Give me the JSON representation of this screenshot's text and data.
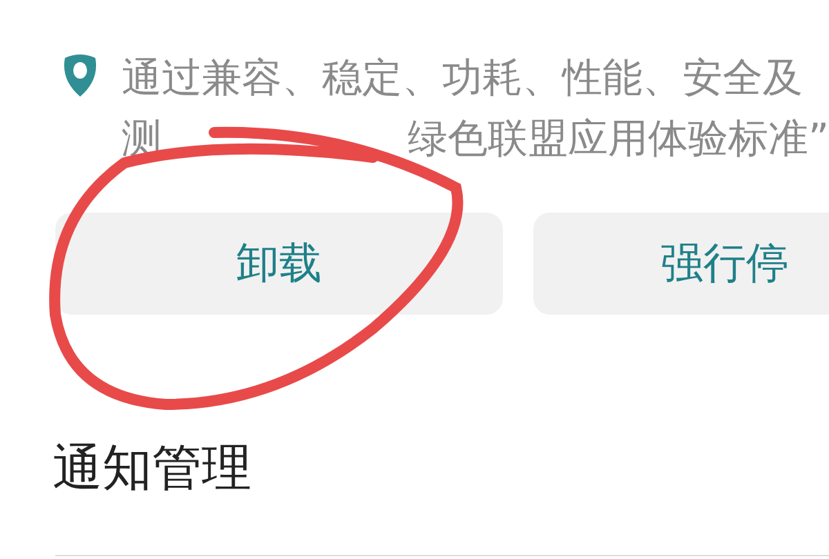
{
  "notice": {
    "line_1": "通过兼容、稳定、功耗、性能、安全及",
    "line_2_start": "测",
    "line_2_end": "绿色联盟应用体验标准”"
  },
  "buttons": [
    {
      "label": "卸载"
    },
    {
      "label": "强行停"
    }
  ],
  "section": {
    "title": "通知管理"
  }
}
